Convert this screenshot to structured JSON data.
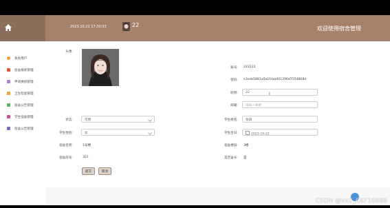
{
  "header": {
    "datetime": "2023.10.22 17:30:33",
    "username": "22",
    "app_title": "欢迎使用宿舍管理"
  },
  "sidebar": {
    "items": [
      {
        "label": "系统用户",
        "icon": "user-icon",
        "color": "#f0a030"
      },
      {
        "label": "宿舍报修管理",
        "icon": "repair-icon",
        "color": "#e0533a"
      },
      {
        "label": "申请换宿管理",
        "icon": "swap-icon",
        "color": "#b07fd0"
      },
      {
        "label": "卫生检查管理",
        "icon": "check-icon",
        "color": "#f0a830"
      },
      {
        "label": "宿舍公告管理",
        "icon": "notice-icon",
        "color": "#5bb75b"
      },
      {
        "label": "学生宿舍管理",
        "icon": "student-icon",
        "color": "#d64ba0"
      },
      {
        "label": "宿舍公告管理",
        "icon": "announce-icon",
        "color": "#7b68c8"
      }
    ]
  },
  "form": {
    "avatar_label": "头像:",
    "account_label": "账号:",
    "account_value": "222222",
    "password_label": "密码:",
    "password_value": "e3ceb5881a0a1fdaad01296d7554868d",
    "nickname_label": "昵称:",
    "nickname_value": "22",
    "email_label": "邮箱:",
    "email_placeholder": "请输入邮箱",
    "status_label": "状态:",
    "status_value": "可用",
    "student_name_label": "学生姓名:",
    "student_name_value": "张四",
    "gender_label": "学生性别:",
    "gender_value": "女",
    "birthday_label": "学生生日:",
    "birthday_value": "2023-10-22",
    "dorm_name_label": "宿舍名称:",
    "dorm_name_value": "1号楼",
    "dorm_floor_label": "宿舍楼层:",
    "dorm_floor_value": "3楼",
    "dorm_no_label": "宿舍房号:",
    "dorm_no_value": "301",
    "is_leader_label": "是否舍长:",
    "is_leader_value": "是"
  },
  "buttons": {
    "submit": "提交",
    "cancel": "取消"
  },
  "watermark": "CSDN @vx2_CKF10088",
  "colors": {
    "topbar": "#a6826d",
    "accent": "#4a90d9"
  }
}
